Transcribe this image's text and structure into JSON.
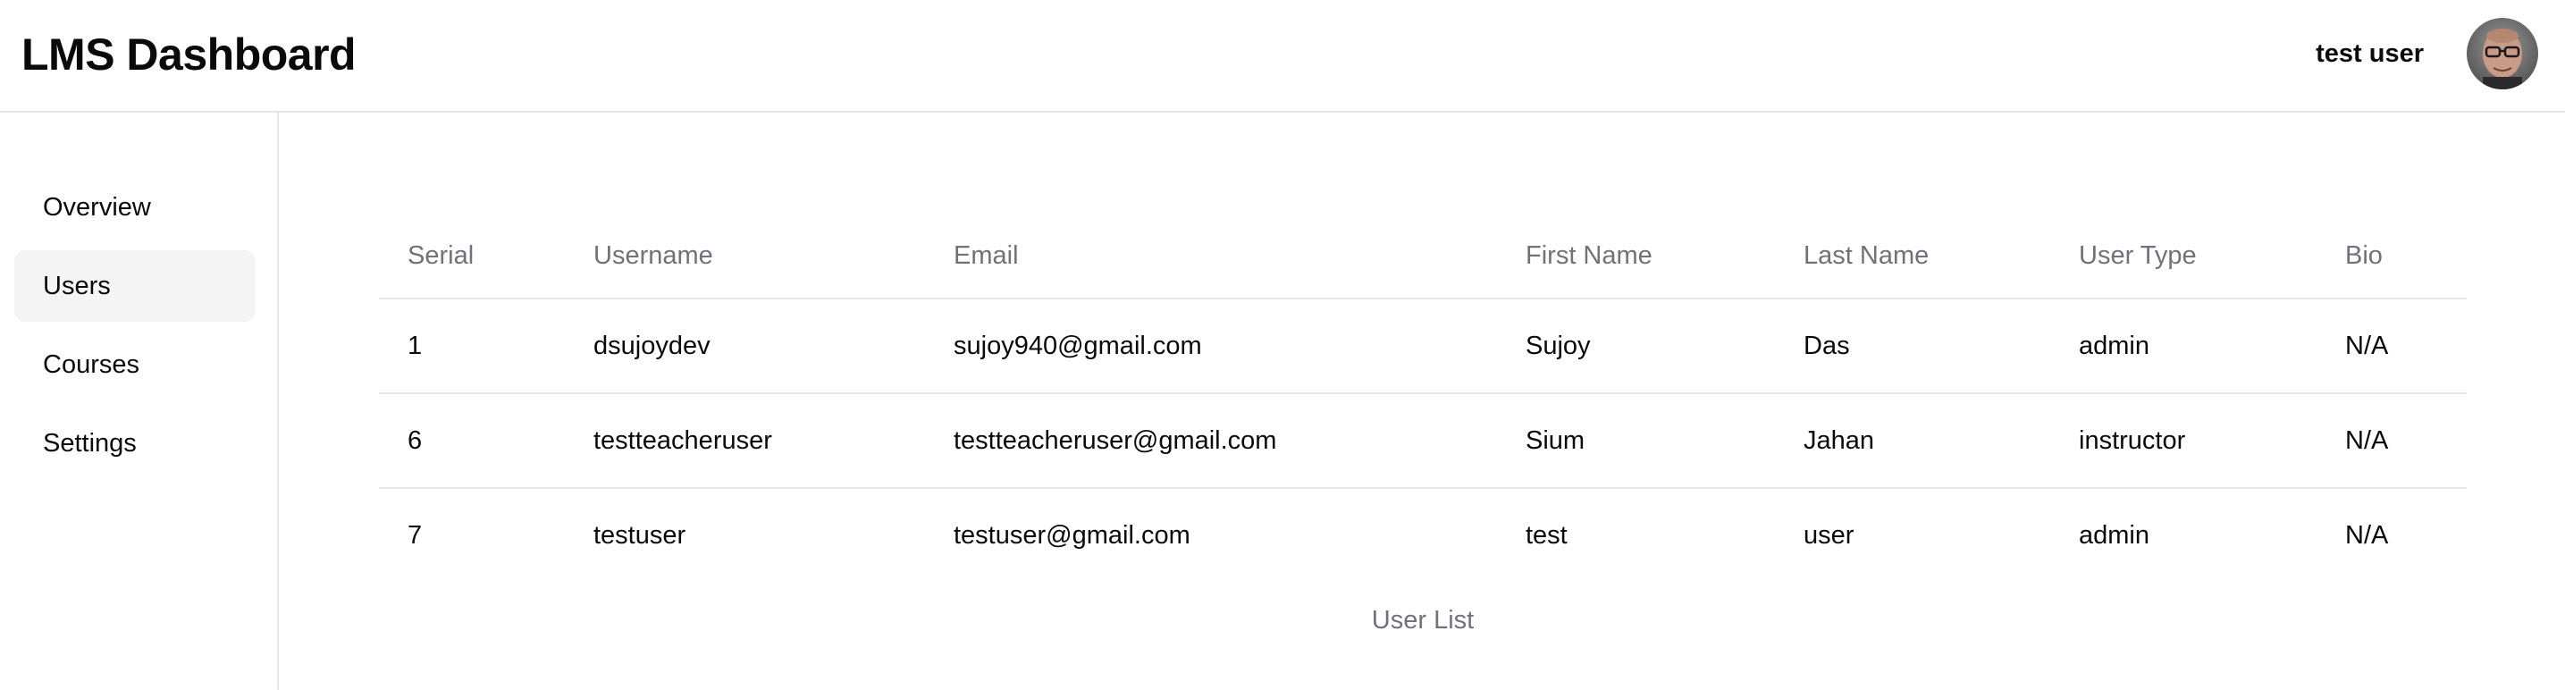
{
  "header": {
    "title": "LMS Dashboard",
    "user_name": "test user",
    "avatar_icon": "user-avatar"
  },
  "sidebar": {
    "items": [
      {
        "label": "Overview",
        "active": false
      },
      {
        "label": "Users",
        "active": true
      },
      {
        "label": "Courses",
        "active": false
      },
      {
        "label": "Settings",
        "active": false
      }
    ]
  },
  "table": {
    "columns": [
      "Serial",
      "Username",
      "Email",
      "First Name",
      "Last Name",
      "User Type",
      "Bio"
    ],
    "rows": [
      [
        "1",
        "dsujoydev",
        "sujoy940@gmail.com",
        "Sujoy",
        "Das",
        "admin",
        "N/A"
      ],
      [
        "6",
        "testteacheruser",
        "testteacheruser@gmail.com",
        "Sium",
        "Jahan",
        "instructor",
        "N/A"
      ],
      [
        "7",
        "testuser",
        "testuser@gmail.com",
        "test",
        "user",
        "admin",
        "N/A"
      ]
    ],
    "caption": "User List"
  },
  "colors": {
    "border": "#e5e5e5",
    "muted_text": "#71717a",
    "active_nav_bg": "#f4f4f5"
  }
}
